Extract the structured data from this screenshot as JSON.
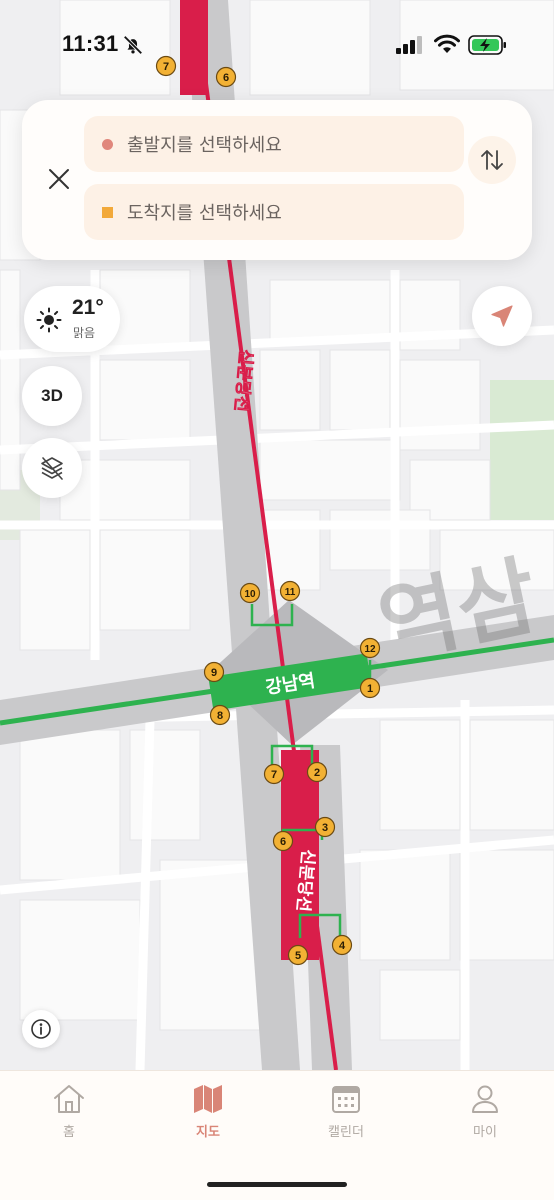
{
  "status_bar": {
    "time": "11:31"
  },
  "route": {
    "origin_placeholder": "출발지를 선택하세요",
    "destination_placeholder": "도착지를 선택하세요"
  },
  "weather": {
    "temperature": "21°",
    "condition": "맑음"
  },
  "controls": {
    "three_d_label": "3D"
  },
  "map": {
    "station_label": "강남역",
    "line_label_north": "신분당선",
    "line_label_south": "신분당선",
    "area_label": "역삼",
    "exits": [
      "1",
      "2",
      "3",
      "4",
      "5",
      "6",
      "7",
      "8",
      "9",
      "10",
      "11",
      "12"
    ],
    "top_exits": [
      "7",
      "6"
    ],
    "colors": {
      "shinbundang": "#d91e4a",
      "line2": "#2eb24f",
      "exit_badge": "#f2b134",
      "accent": "#d98577"
    }
  },
  "tabs": [
    {
      "label": "홈",
      "icon": "home-icon",
      "active": false
    },
    {
      "label": "지도",
      "icon": "map-icon",
      "active": true
    },
    {
      "label": "캘린더",
      "icon": "calendar-icon",
      "active": false
    },
    {
      "label": "마이",
      "icon": "person-icon",
      "active": false
    }
  ]
}
